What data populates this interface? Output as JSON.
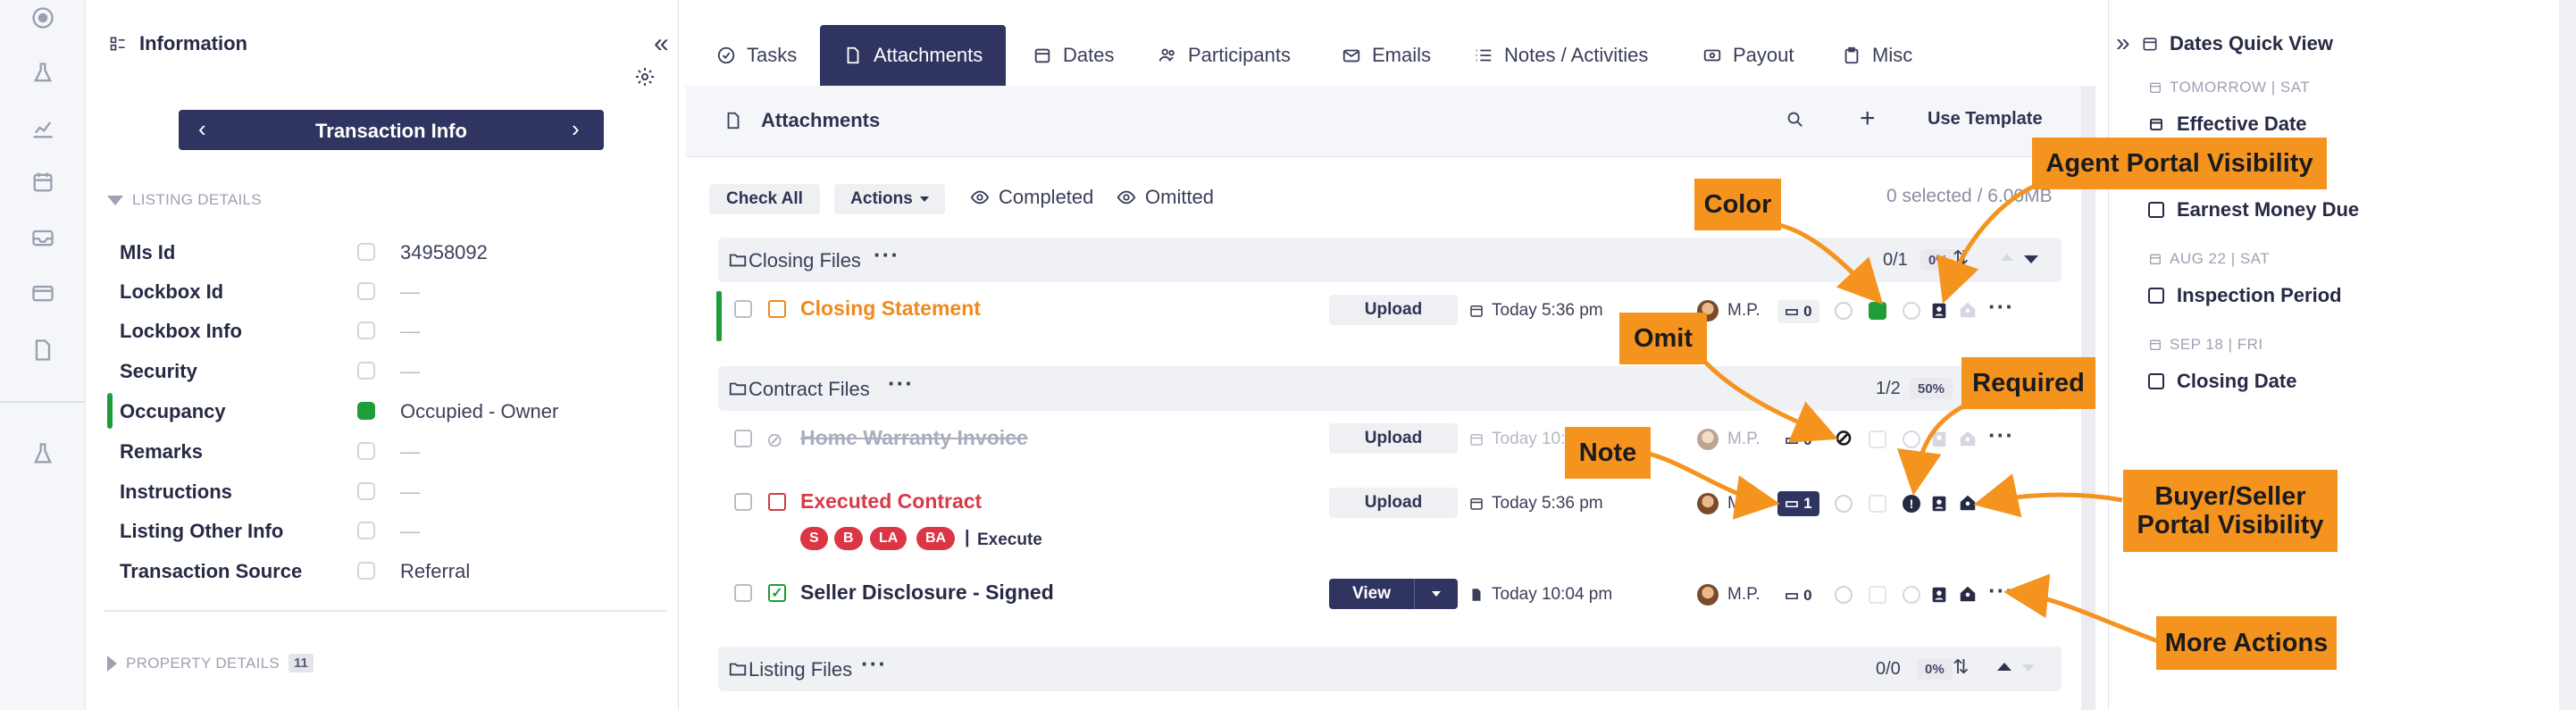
{
  "sidebar_icons": [
    "circle-dot-icon",
    "flask-icon",
    "chart-icon",
    "calendar-icon",
    "inbox-icon",
    "card-icon",
    "file-icon",
    "lab-icon"
  ],
  "left": {
    "header": "Information",
    "banner": "Transaction Info",
    "section_listing": "LISTING DETAILS",
    "fields": [
      {
        "label": "Mls Id",
        "value": "34958092"
      },
      {
        "label": "Lockbox Id",
        "value": "—"
      },
      {
        "label": "Lockbox Info",
        "value": "—"
      },
      {
        "label": "Security",
        "value": "—"
      },
      {
        "label": "Occupancy",
        "value": "Occupied - Owner"
      },
      {
        "label": "Remarks",
        "value": "—"
      },
      {
        "label": "Instructions",
        "value": "—"
      },
      {
        "label": "Listing Other Info",
        "value": "—"
      },
      {
        "label": "Transaction Source",
        "value": "Referral"
      }
    ],
    "section_property": "PROPERTY DETAILS",
    "property_count": "11"
  },
  "tabs": [
    "Tasks",
    "Attachments",
    "Dates",
    "Participants",
    "Emails",
    "Notes / Activities",
    "Payout",
    "Misc"
  ],
  "attachments": {
    "title": "Attachments",
    "use_template": "Use Template",
    "check_all": "Check All",
    "actions": "Actions",
    "completed": "Completed",
    "omitted": "Omitted",
    "selected_info": "0 selected / 6.00MB",
    "sections": [
      {
        "title": "Closing Files",
        "count": "0/1",
        "pct": "0%"
      },
      {
        "title": "Contract Files",
        "count": "1/2",
        "pct": "50%"
      },
      {
        "title": "Listing Files",
        "count": "0/0",
        "pct": "0%"
      }
    ],
    "rows": [
      {
        "name": "Closing Statement",
        "button": "Upload",
        "date": "Today 5:36 pm",
        "initials": "M.P.",
        "comments": "0"
      },
      {
        "name": "Home Warranty Invoice",
        "button": "Upload",
        "date": "Today 10:04",
        "initials": "M.P.",
        "comments": "0"
      },
      {
        "name": "Executed Contract",
        "button": "Upload",
        "date": "Today 5:36 pm",
        "initials": "M.",
        "comments": "1"
      },
      {
        "name": "Seller Disclosure - Signed",
        "button": "View",
        "date": "Today 10:04 pm",
        "initials": "M.P.",
        "comments": "0"
      }
    ],
    "tags": [
      "S",
      "B",
      "LA",
      "BA"
    ],
    "execute": "Execute"
  },
  "callouts": {
    "color": "Color",
    "agent_portal": "Agent Portal Visibility",
    "omit": "Omit",
    "required": "Required",
    "note": "Note",
    "buyer_seller_1": "Buyer/Seller",
    "buyer_seller_2": "Portal Visibility",
    "more_actions": "More Actions"
  },
  "dates_quick_view": {
    "title": "Dates Quick View",
    "groups": [
      {
        "date": "TOMORROW | SAT",
        "items": [
          "Effective Date"
        ]
      },
      {
        "date": "",
        "items": [
          "Earnest Money Due"
        ]
      },
      {
        "date": "AUG 22 | SAT",
        "items": [
          "Inspection Period"
        ]
      },
      {
        "date": "SEP 18 | FRI",
        "items": [
          "Closing Date"
        ]
      }
    ]
  },
  "colors": {
    "navy": "#2f3560",
    "orange_callout": "#f5931f",
    "row_orange": "#f08a1c",
    "row_red": "#d93848",
    "green": "#1f9d3a"
  }
}
